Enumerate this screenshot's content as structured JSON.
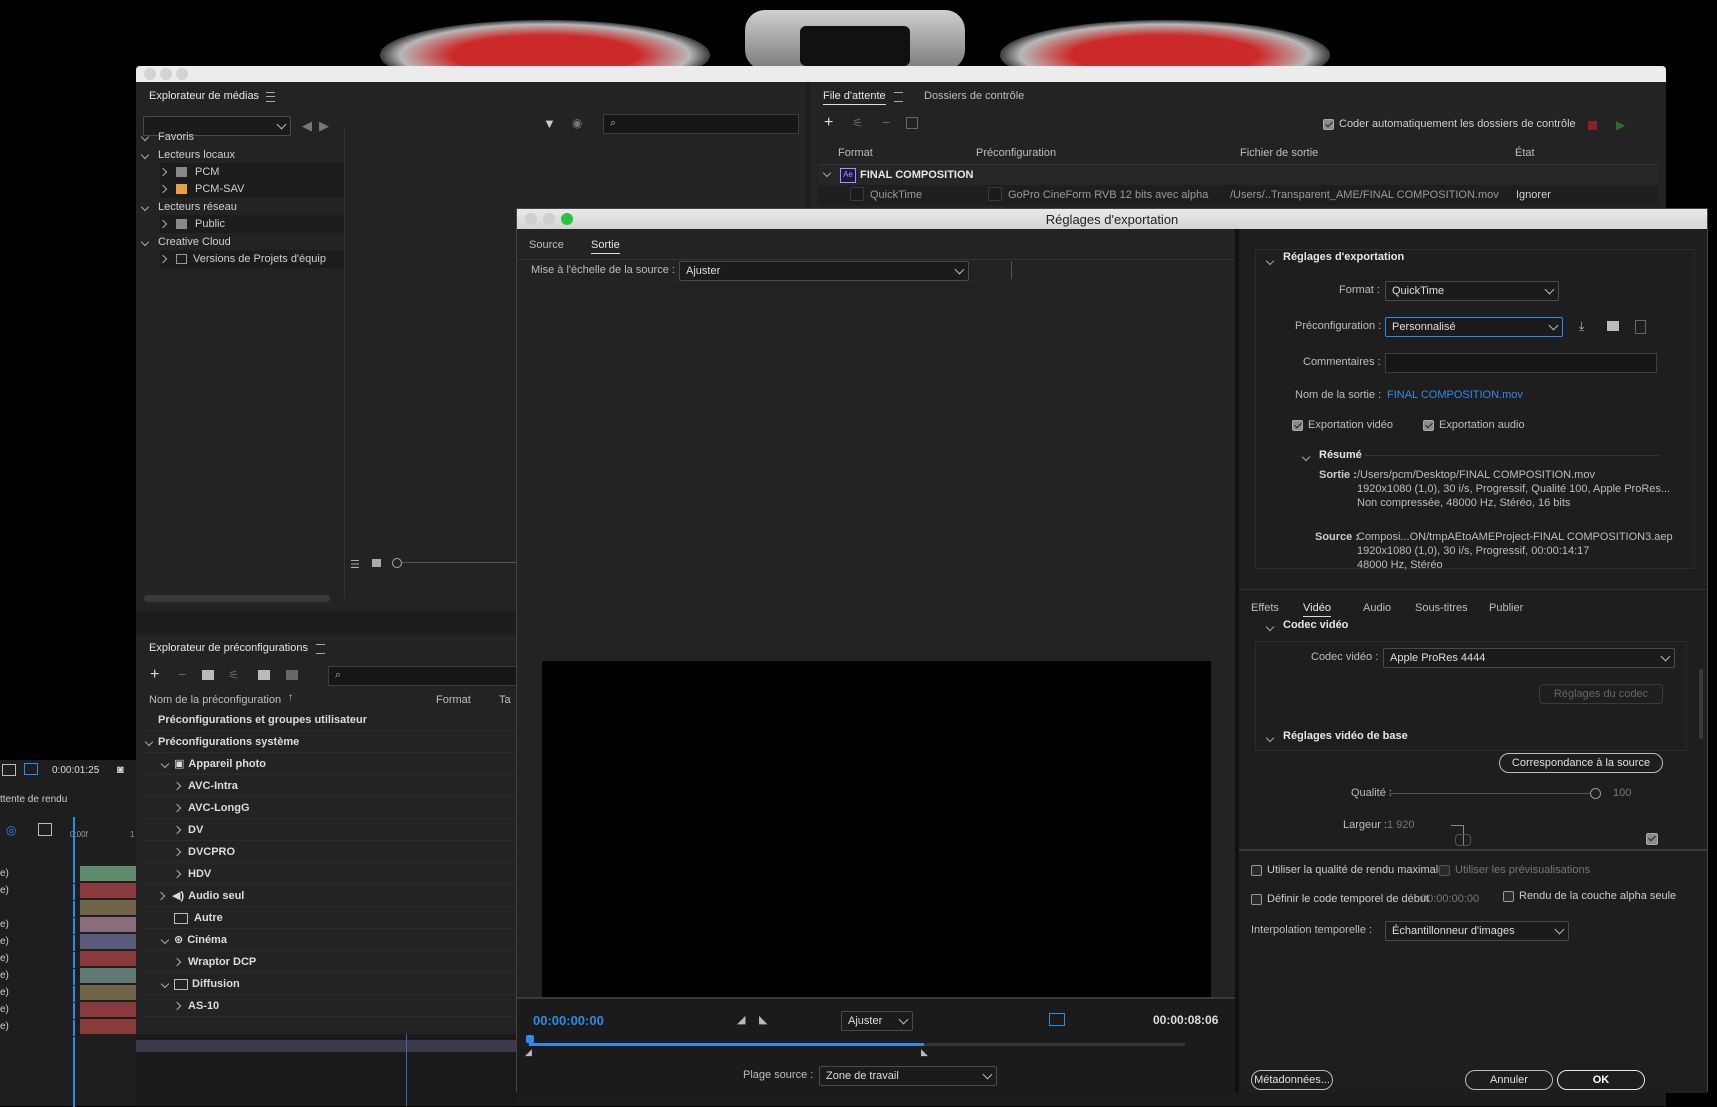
{
  "media_browser": {
    "title": "Explorateur de médias",
    "tree": [
      "Favoris",
      "Lecteurs locaux",
      "PCM",
      "PCM-SAV",
      "Lecteurs réseau",
      "Public",
      "Creative Cloud",
      "Versions de Projets d'équip"
    ]
  },
  "queue": {
    "tab_queue": "File d'attente",
    "tab_watch": "Dossiers de contrôle",
    "auto_encode": "Coder automatiquement les dossiers de contrôle",
    "col_format": "Format",
    "col_preset": "Préconfiguration",
    "col_output": "Fichier de sortie",
    "col_status": "État",
    "group": "FINAL COMPOSITION",
    "item_format": "QuickTime",
    "item_preset": "GoPro CineForm RVB 12 bits avec alpha",
    "item_output": "/Users/..Transparent_AME/FINAL COMPOSITION.mov",
    "item_status": "Ignorer"
  },
  "preset_browser": {
    "title": "Explorateur de préconfigurations",
    "col_name": "Nom de la préconfiguration",
    "col_format": "Format",
    "col_t": "Ta",
    "rows": [
      "Préconfigurations et groupes utilisateur",
      "Préconfigurations système",
      "Appareil photo",
      "AVC-Intra",
      "AVC-LongG",
      "DV",
      "DVCPRO",
      "HDV",
      "Audio seul",
      "Autre",
      "Cinéma",
      "Wraptor DCP",
      "Diffusion",
      "AS-10"
    ]
  },
  "timeline": {
    "timecode": "0:00:01:25",
    "label": "ttente de rendu",
    "ruler0": "0:00f",
    "ruler1": "1",
    "row_label": "e)"
  },
  "export": {
    "title": "Réglages d'exportation",
    "tab_source": "Source",
    "tab_output": "Sortie",
    "scale_label": "Mise à l'échelle de la source :",
    "scale_value": "Ajuster",
    "time_start": "00:00:00:00",
    "time_end": "00:00:08:06",
    "fit_value": "Ajuster",
    "range_label": "Plage source :",
    "range_value": "Zone de travail",
    "settings_header": "Réglages d'exportation",
    "format_label": "Format :",
    "format_value": "QuickTime",
    "preset_label": "Préconfiguration :",
    "preset_value": "Personnalisé",
    "comments_label": "Commentaires :",
    "output_label": "Nom de la sortie :",
    "output_value": "FINAL COMPOSITION.mov",
    "export_video": "Exportation vidéo",
    "export_audio": "Exportation audio",
    "summary_header": "Résumé",
    "out_label": "Sortie :",
    "out_line1": "/Users/pcm/Desktop/FINAL COMPOSITION.mov",
    "out_line2": "1920x1080 (1,0), 30 i/s, Progressif, Qualité  100, Apple ProRes...",
    "out_line3": "Non compressée, 48000  Hz, Stéréo, 16 bits",
    "src_label": "Source :",
    "src_line1": "Composi...ON/tmpAEtoAMEProject-FINAL COMPOSITION3.aep",
    "src_line2": "1920x1080 (1,0), 30 i/s, Progressif, 00:00:14:17",
    "src_line3": "48000 Hz, Stéréo",
    "tabs": [
      "Effets",
      "Vidéo",
      "Audio",
      "Sous-titres",
      "Publier"
    ],
    "codec_header": "Codec vidéo",
    "codec_label": "Codec vidéo :",
    "codec_value": "Apple ProRes 4444",
    "codec_settings": "Réglages du codec",
    "basic_header": "Réglages vidéo de base",
    "match_source": "Correspondance à la source",
    "quality_label": "Qualité :",
    "quality_value": "100",
    "quality_level": 1.0,
    "width_label": "Largeur :",
    "width_value": "1 920",
    "max_quality": "Utiliser la qualité de rendu maximale",
    "use_previews": "Utiliser les prévisualisations",
    "set_timecode": "Définir le code temporel de début",
    "timecode_value": "00:00:00:00",
    "alpha_only": "Rendu de la couche alpha seule",
    "interp_label": "Interpolation temporelle :",
    "interp_value": "Échantillonneur d'images",
    "metadata": "Métadonnées...",
    "cancel": "Annuler",
    "ok": "OK"
  },
  "colors": {
    "accent": "#2d8ceb",
    "panel": "#232323",
    "dialog": "#1e1e1e"
  }
}
